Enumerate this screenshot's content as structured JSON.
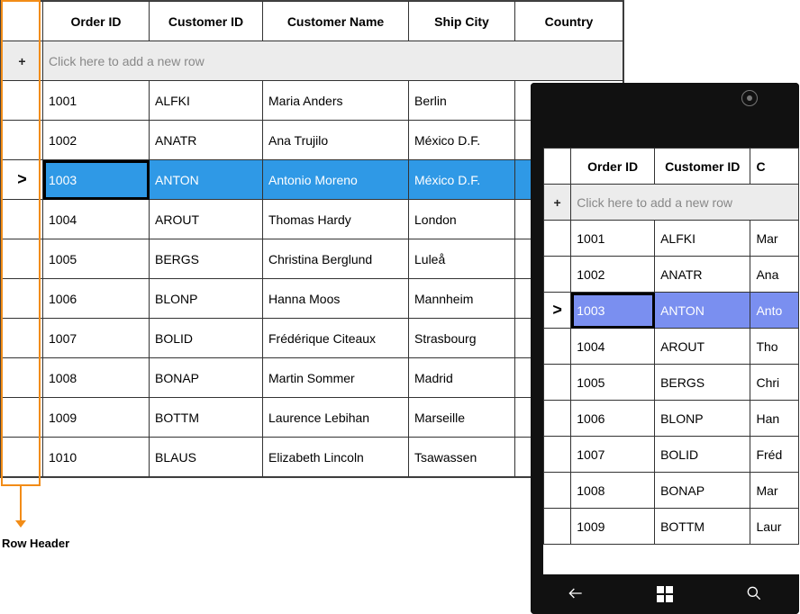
{
  "annotation": {
    "row_header_label": "Row Header"
  },
  "desktop": {
    "columns": [
      "Order ID",
      "Customer ID",
      "Customer Name",
      "Ship City",
      "Country"
    ],
    "add_row_placeholder": "Click here to add a new row",
    "plus_glyph": "+",
    "selected_marker": ">",
    "rows": [
      {
        "order_id": "1001",
        "customer_id": "ALFKI",
        "customer_name": "Maria Anders",
        "ship_city": "Berlin",
        "country": ""
      },
      {
        "order_id": "1002",
        "customer_id": "ANATR",
        "customer_name": "Ana Trujilo",
        "ship_city": "México D.F.",
        "country": ""
      },
      {
        "order_id": "1003",
        "customer_id": "ANTON",
        "customer_name": "Antonio Moreno",
        "ship_city": "México D.F.",
        "country": ""
      },
      {
        "order_id": "1004",
        "customer_id": "AROUT",
        "customer_name": "Thomas Hardy",
        "ship_city": "London",
        "country": ""
      },
      {
        "order_id": "1005",
        "customer_id": "BERGS",
        "customer_name": "Christina Berglund",
        "ship_city": "Luleå",
        "country": ""
      },
      {
        "order_id": "1006",
        "customer_id": "BLONP",
        "customer_name": "Hanna Moos",
        "ship_city": "Mannheim",
        "country": ""
      },
      {
        "order_id": "1007",
        "customer_id": "BOLID",
        "customer_name": "Frédérique Citeaux",
        "ship_city": "Strasbourg",
        "country": ""
      },
      {
        "order_id": "1008",
        "customer_id": "BONAP",
        "customer_name": "Martin Sommer",
        "ship_city": "Madrid",
        "country": ""
      },
      {
        "order_id": "1009",
        "customer_id": "BOTTM",
        "customer_name": "Laurence Lebihan",
        "ship_city": "Marseille",
        "country": ""
      },
      {
        "order_id": "1010",
        "customer_id": "BLAUS",
        "customer_name": "Elizabeth Lincoln",
        "ship_city": "Tsawassen",
        "country": ""
      }
    ],
    "selected_index": 2
  },
  "phone": {
    "columns": [
      "Order ID",
      "Customer ID",
      "C"
    ],
    "add_row_placeholder": "Click here to add a new row",
    "plus_glyph": "+",
    "selected_marker": ">",
    "rows": [
      {
        "order_id": "1001",
        "customer_id": "ALFKI",
        "name_frag": "Mar"
      },
      {
        "order_id": "1002",
        "customer_id": "ANATR",
        "name_frag": "Ana"
      },
      {
        "order_id": "1003",
        "customer_id": "ANTON",
        "name_frag": "Anto"
      },
      {
        "order_id": "1004",
        "customer_id": "AROUT",
        "name_frag": "Tho"
      },
      {
        "order_id": "1005",
        "customer_id": "BERGS",
        "name_frag": "Chri"
      },
      {
        "order_id": "1006",
        "customer_id": "BLONP",
        "name_frag": "Han"
      },
      {
        "order_id": "1007",
        "customer_id": "BOLID",
        "name_frag": "Fréd"
      },
      {
        "order_id": "1008",
        "customer_id": "BONAP",
        "name_frag": "Mar"
      },
      {
        "order_id": "1009",
        "customer_id": "BOTTM",
        "name_frag": "Laur"
      }
    ],
    "selected_index": 2
  }
}
